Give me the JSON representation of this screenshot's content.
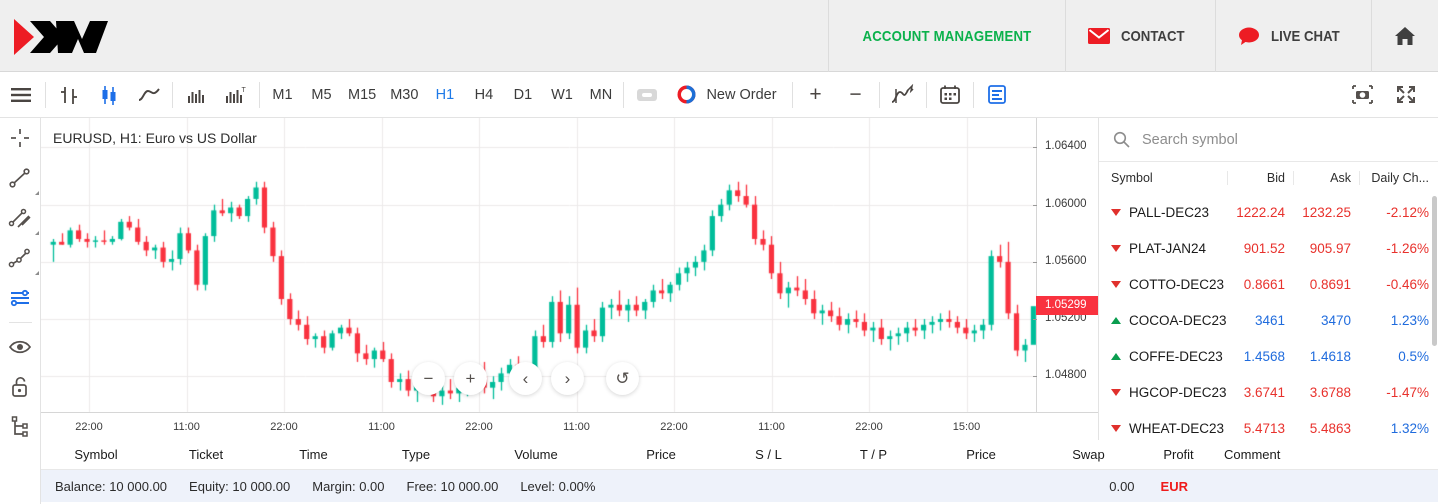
{
  "header": {
    "logo_text": "XM",
    "account_management": "ACCOUNT MANAGEMENT",
    "contact": "CONTACT",
    "live_chat": "LIVE CHAT",
    "home_icon": "home-icon",
    "accent_green": "#0ab14b",
    "accent_red": "#ed1c24"
  },
  "toolbar": {
    "menu_icon": "hamburger-menu-icon",
    "chart_types": [
      {
        "name": "bar-chart-icon",
        "active": false
      },
      {
        "name": "candlestick-chart-icon",
        "active": true
      },
      {
        "name": "line-chart-icon",
        "active": false
      }
    ],
    "volume_icons": [
      {
        "name": "volume-icon",
        "active": false
      },
      {
        "name": "volume-template-icon",
        "active": false
      }
    ],
    "timeframes": [
      {
        "label": "M1",
        "active": false
      },
      {
        "label": "M5",
        "active": false
      },
      {
        "label": "M15",
        "active": false
      },
      {
        "label": "M30",
        "active": false
      },
      {
        "label": "H1",
        "active": true
      },
      {
        "label": "H4",
        "active": false
      },
      {
        "label": "D1",
        "active": false
      },
      {
        "label": "W1",
        "active": false
      },
      {
        "label": "MN",
        "active": false
      }
    ],
    "one_click_icon": "one-click-trading-icon",
    "new_order_label": "New Order",
    "new_order_icon": "new-order-clock-icon",
    "zoom_in": "+",
    "zoom_out": "−",
    "indicators_icon": "indicators-icon",
    "calendar_icon": "calendar-icon",
    "objects_icon": "objects-list-icon",
    "screenshot_icon": "screenshot-camera-icon",
    "fullscreen_icon": "fullscreen-expand-icon"
  },
  "left_rail": {
    "tools": [
      {
        "name": "crosshair-tool",
        "active": false,
        "has_corner": false
      },
      {
        "name": "trend-line-tool",
        "active": false,
        "has_corner": true
      },
      {
        "name": "parallel-channel-tool",
        "active": false,
        "has_corner": true
      },
      {
        "name": "polyline-tool",
        "active": false,
        "has_corner": true
      },
      {
        "name": "horizontal-lines-tool",
        "active": true,
        "has_corner": false
      },
      {
        "name": "visibility-eye-tool",
        "active": false,
        "has_corner": false
      },
      {
        "name": "unlock-tool",
        "active": false,
        "has_corner": false
      },
      {
        "name": "object-tree-tool",
        "active": false,
        "has_corner": false
      },
      {
        "name": "objects-panel-tool",
        "active": false,
        "has_corner": false
      }
    ]
  },
  "chart_data": {
    "type": "candlestick",
    "title": "EURUSD, H1: Euro vs US Dollar",
    "symbol": "EURUSD",
    "timeframe": "H1",
    "description": "Euro vs US Dollar",
    "current_price": "1.05299",
    "current_price_value": 1.05299,
    "up_color": "#00bd9a",
    "down_color": "#f9323f",
    "ylim": [
      1.0455,
      1.0655
    ],
    "y_ticks": [
      "1.06400",
      "1.06000",
      "1.05600",
      "1.05200",
      "1.04800"
    ],
    "y_tick_values": [
      1.064,
      1.06,
      1.056,
      1.052,
      1.048
    ],
    "x_ticks": [
      "22:00",
      "11:00",
      "22:00",
      "11:00",
      "22:00",
      "11:00",
      "22:00",
      "11:00",
      "22:00",
      "15:00"
    ],
    "grid": true,
    "ohlc": [
      [
        1.0572,
        1.0576,
        1.056,
        1.0574
      ],
      [
        1.0574,
        1.058,
        1.0572,
        1.0572
      ],
      [
        1.0572,
        1.0584,
        1.057,
        1.0582
      ],
      [
        1.0582,
        1.0586,
        1.0574,
        1.0576
      ],
      [
        1.0576,
        1.058,
        1.057,
        1.0574
      ],
      [
        1.0574,
        1.0578,
        1.057,
        1.0575
      ],
      [
        1.0575,
        1.0582,
        1.0572,
        1.0574
      ],
      [
        1.0574,
        1.0578,
        1.0572,
        1.0576
      ],
      [
        1.0576,
        1.059,
        1.0575,
        1.0588
      ],
      [
        1.0588,
        1.0592,
        1.0582,
        1.0584
      ],
      [
        1.0584,
        1.059,
        1.0572,
        1.0574
      ],
      [
        1.0574,
        1.0578,
        1.0564,
        1.0568
      ],
      [
        1.0568,
        1.0572,
        1.0562,
        1.057
      ],
      [
        1.057,
        1.0574,
        1.0556,
        1.056
      ],
      [
        1.056,
        1.0568,
        1.0554,
        1.0562
      ],
      [
        1.0562,
        1.0584,
        1.0558,
        1.058
      ],
      [
        1.058,
        1.0584,
        1.0566,
        1.0568
      ],
      [
        1.0568,
        1.0572,
        1.054,
        1.0544
      ],
      [
        1.0544,
        1.058,
        1.054,
        1.0578
      ],
      [
        1.0578,
        1.06,
        1.0574,
        1.0596
      ],
      [
        1.0596,
        1.0604,
        1.0592,
        1.0594
      ],
      [
        1.0594,
        1.0602,
        1.0588,
        1.0598
      ],
      [
        1.0598,
        1.06,
        1.059,
        1.0592
      ],
      [
        1.0592,
        1.0606,
        1.0588,
        1.0604
      ],
      [
        1.0604,
        1.0616,
        1.06,
        1.0612
      ],
      [
        1.0612,
        1.0616,
        1.058,
        1.0584
      ],
      [
        1.0584,
        1.0588,
        1.056,
        1.0564
      ],
      [
        1.0564,
        1.0568,
        1.053,
        1.0534
      ],
      [
        1.0534,
        1.0538,
        1.0516,
        1.052
      ],
      [
        1.052,
        1.0526,
        1.0512,
        1.0516
      ],
      [
        1.0516,
        1.0522,
        1.0502,
        1.0506
      ],
      [
        1.0506,
        1.051,
        1.05,
        1.0508
      ],
      [
        1.0508,
        1.0512,
        1.0496,
        1.05
      ],
      [
        1.05,
        1.0512,
        1.0498,
        1.051
      ],
      [
        1.051,
        1.0516,
        1.0506,
        1.0514
      ],
      [
        1.0514,
        1.052,
        1.0508,
        1.051
      ],
      [
        1.051,
        1.0514,
        1.049,
        1.0496
      ],
      [
        1.0496,
        1.0502,
        1.0488,
        1.0492
      ],
      [
        1.0492,
        1.05,
        1.0486,
        1.0498
      ],
      [
        1.0498,
        1.0504,
        1.049,
        1.0492
      ],
      [
        1.0492,
        1.0496,
        1.0472,
        1.0476
      ],
      [
        1.0476,
        1.0482,
        1.047,
        1.0478
      ],
      [
        1.0478,
        1.0484,
        1.0466,
        1.047
      ],
      [
        1.047,
        1.0478,
        1.0462,
        1.0474
      ],
      [
        1.0474,
        1.048,
        1.0468,
        1.0472
      ],
      [
        1.0472,
        1.0478,
        1.0462,
        1.0466
      ],
      [
        1.0466,
        1.0474,
        1.046,
        1.047
      ],
      [
        1.047,
        1.0478,
        1.0464,
        1.0468
      ],
      [
        1.0468,
        1.0476,
        1.0462,
        1.0472
      ],
      [
        1.0472,
        1.048,
        1.0466,
        1.0476
      ],
      [
        1.0476,
        1.0484,
        1.047,
        1.048
      ],
      [
        1.048,
        1.049,
        1.0468,
        1.0472
      ],
      [
        1.0472,
        1.048,
        1.0464,
        1.0476
      ],
      [
        1.0476,
        1.0486,
        1.047,
        1.0482
      ],
      [
        1.0482,
        1.0492,
        1.0476,
        1.0488
      ],
      [
        1.0488,
        1.0494,
        1.047,
        1.0474
      ],
      [
        1.0474,
        1.0482,
        1.0468,
        1.0478
      ],
      [
        1.0478,
        1.0512,
        1.0474,
        1.0508
      ],
      [
        1.0508,
        1.0516,
        1.05,
        1.0504
      ],
      [
        1.0504,
        1.0536,
        1.05,
        1.0532
      ],
      [
        1.0532,
        1.054,
        1.0504,
        1.051
      ],
      [
        1.051,
        1.0536,
        1.0506,
        1.053
      ],
      [
        1.053,
        1.0542,
        1.0496,
        1.05
      ],
      [
        1.05,
        1.0516,
        1.0496,
        1.0512
      ],
      [
        1.0512,
        1.052,
        1.0504,
        1.0508
      ],
      [
        1.0508,
        1.0532,
        1.0504,
        1.0528
      ],
      [
        1.0528,
        1.0534,
        1.052,
        1.053
      ],
      [
        1.053,
        1.054,
        1.0522,
        1.0526
      ],
      [
        1.0526,
        1.0534,
        1.0518,
        1.053
      ],
      [
        1.053,
        1.0536,
        1.0522,
        1.0526
      ],
      [
        1.0526,
        1.0534,
        1.052,
        1.0532
      ],
      [
        1.0532,
        1.0544,
        1.0528,
        1.054
      ],
      [
        1.054,
        1.0548,
        1.0534,
        1.0538
      ],
      [
        1.0538,
        1.0546,
        1.0532,
        1.0544
      ],
      [
        1.0544,
        1.0556,
        1.054,
        1.0552
      ],
      [
        1.0552,
        1.056,
        1.0546,
        1.0556
      ],
      [
        1.0556,
        1.0564,
        1.055,
        1.056
      ],
      [
        1.056,
        1.0572,
        1.0554,
        1.0568
      ],
      [
        1.0568,
        1.0596,
        1.0564,
        1.0592
      ],
      [
        1.0592,
        1.0604,
        1.0588,
        1.06
      ],
      [
        1.06,
        1.0614,
        1.0596,
        1.061
      ],
      [
        1.061,
        1.0616,
        1.0602,
        1.0606
      ],
      [
        1.0606,
        1.0614,
        1.0598,
        1.06
      ],
      [
        1.06,
        1.0606,
        1.0572,
        1.0576
      ],
      [
        1.0576,
        1.0582,
        1.0568,
        1.0572
      ],
      [
        1.0572,
        1.0578,
        1.0548,
        1.0552
      ],
      [
        1.0552,
        1.056,
        1.0534,
        1.0538
      ],
      [
        1.0538,
        1.0546,
        1.0528,
        1.0542
      ],
      [
        1.0542,
        1.055,
        1.0536,
        1.054
      ],
      [
        1.054,
        1.0548,
        1.053,
        1.0534
      ],
      [
        1.0534,
        1.054,
        1.052,
        1.0524
      ],
      [
        1.0524,
        1.053,
        1.0516,
        1.0526
      ],
      [
        1.0526,
        1.0532,
        1.0518,
        1.0522
      ],
      [
        1.0522,
        1.0528,
        1.0512,
        1.0516
      ],
      [
        1.0516,
        1.0524,
        1.051,
        1.052
      ],
      [
        1.052,
        1.0526,
        1.0514,
        1.0518
      ],
      [
        1.0518,
        1.0524,
        1.0508,
        1.0512
      ],
      [
        1.0512,
        1.0518,
        1.0504,
        1.0514
      ],
      [
        1.0514,
        1.052,
        1.0502,
        1.0506
      ],
      [
        1.0506,
        1.0512,
        1.0498,
        1.0508
      ],
      [
        1.0508,
        1.0514,
        1.0502,
        1.051
      ],
      [
        1.051,
        1.0518,
        1.0504,
        1.0514
      ],
      [
        1.0514,
        1.052,
        1.0508,
        1.0512
      ],
      [
        1.0512,
        1.052,
        1.0506,
        1.0516
      ],
      [
        1.0516,
        1.0522,
        1.051,
        1.0518
      ],
      [
        1.0518,
        1.0524,
        1.0512,
        1.052
      ],
      [
        1.052,
        1.0526,
        1.0514,
        1.0518
      ],
      [
        1.0518,
        1.0522,
        1.051,
        1.0514
      ],
      [
        1.0514,
        1.052,
        1.0506,
        1.051
      ],
      [
        1.051,
        1.0516,
        1.0504,
        1.0512
      ],
      [
        1.0512,
        1.052,
        1.0506,
        1.0516
      ],
      [
        1.0516,
        1.0568,
        1.0512,
        1.0564
      ],
      [
        1.0564,
        1.0572,
        1.0556,
        1.056
      ],
      [
        1.056,
        1.0574,
        1.052,
        1.0524
      ],
      [
        1.0524,
        1.053,
        1.0494,
        1.0498
      ],
      [
        1.0498,
        1.0506,
        1.049,
        1.0502
      ],
      [
        1.0502,
        1.0508,
        1.0524,
        1.0529
      ],
      [
        1.0529,
        1.0534,
        1.0526,
        1.053
      ]
    ]
  },
  "nav_buttons": [
    {
      "name": "zoom-out-button",
      "glyph": "−"
    },
    {
      "name": "zoom-in-button",
      "glyph": "+"
    },
    {
      "name": "scroll-left-button",
      "glyph": "‹"
    },
    {
      "name": "scroll-right-button",
      "glyph": "›"
    },
    {
      "name": "reset-chart-button",
      "glyph": "↺"
    }
  ],
  "market_watch": {
    "search_placeholder": "Search symbol",
    "search_value": "",
    "search_icon": "search-icon",
    "columns": [
      "Symbol",
      "Bid",
      "Ask",
      "Daily Ch..."
    ],
    "rows": [
      {
        "symbol": "PALL-DEC23",
        "bid": "1222.24",
        "ask": "1232.25",
        "change": "-2.12%",
        "dir": "down"
      },
      {
        "symbol": "PLAT-JAN24",
        "bid": "901.52",
        "ask": "905.97",
        "change": "-1.26%",
        "dir": "down"
      },
      {
        "symbol": "COTTO-DEC23",
        "bid": "0.8661",
        "ask": "0.8691",
        "change": "-0.46%",
        "dir": "down"
      },
      {
        "symbol": "COCOA-DEC23",
        "bid": "3461",
        "ask": "3470",
        "change": "1.23%",
        "dir": "up"
      },
      {
        "symbol": "COFFE-DEC23",
        "bid": "1.4568",
        "ask": "1.4618",
        "change": "0.5%",
        "dir": "up"
      },
      {
        "symbol": "HGCOP-DEC23",
        "bid": "3.6741",
        "ask": "3.6788",
        "change": "-1.47%",
        "dir": "down"
      },
      {
        "symbol": "WHEAT-DEC23",
        "bid": "5.4713",
        "ask": "5.4863",
        "change": "1.32%",
        "dir": "down"
      }
    ]
  },
  "positions": {
    "columns": [
      "Symbol",
      "Ticket",
      "Time",
      "Type",
      "Volume",
      "Price",
      "S / L",
      "T / P",
      "Price",
      "Swap",
      "Profit",
      "Comment"
    ],
    "status": {
      "balance": "Balance: 10 000.00",
      "equity": "Equity: 10 000.00",
      "margin": "Margin: 0.00",
      "free": "Free: 10 000.00",
      "level": "Level: 0.00%",
      "profit": "0.00",
      "comment": "EUR"
    }
  }
}
